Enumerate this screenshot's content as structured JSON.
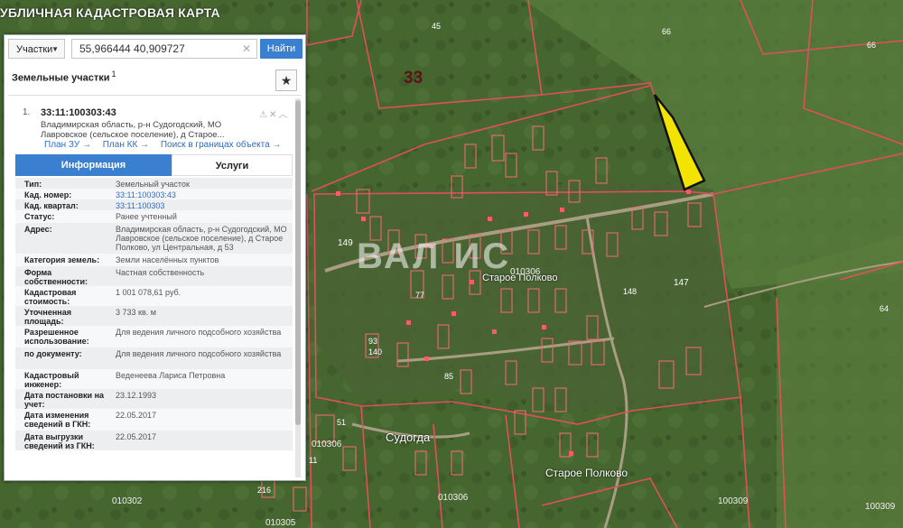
{
  "app_title": "УБЛИЧНАЯ КАДАСТРОВАЯ КАРТА",
  "search": {
    "type_label": "Участки",
    "query": "55,966444 40,909727",
    "button_label": "Найти"
  },
  "section": {
    "title": "Земельные участки",
    "count": "1"
  },
  "item": {
    "number": "1.",
    "cadastral_id": "33:11:100303:43",
    "address_short": "Владимирская область, р-н Судогодский, МО Лавровское (сельское поселение), д Старое...",
    "links": [
      "План ЗУ →",
      "План КК →",
      "Поиск в границах объекта →"
    ]
  },
  "tabs": {
    "info": "Информация",
    "services": "Услуги"
  },
  "details": [
    {
      "k": "Тип:",
      "v": "Земельный участок"
    },
    {
      "k": "Кад. номер:",
      "v": "33:11:100303:43",
      "link": true
    },
    {
      "k": "Кад. квартал:",
      "v": "33:11:100303",
      "link": true
    },
    {
      "k": "Статус:",
      "v": "Ранее учтенный"
    },
    {
      "k": "Адрес:",
      "v": "Владимирская область, р-н Судогодский, МО Лавровское (сельское поселение), д Старое Полково, ул Центральная, д 53"
    },
    {
      "k": "Категория земель:",
      "v": "Земли населённых пунктов"
    },
    {
      "k": "Форма собственности:",
      "v": "Частная собственность"
    },
    {
      "k": "Кадастровая стоимость:",
      "v": "1 001 078,61 руб."
    },
    {
      "k": "Уточненная площадь:",
      "v": "3 733 кв. м"
    },
    {
      "k": "Разрешенное использование:",
      "v": "Для ведения личного подсобного хозяйства"
    },
    {
      "k": "по документу:",
      "v": "Для ведения личного подсобного хозяйства"
    },
    {
      "k": "Кадастровый инженер:",
      "v": "Веденеева Лариса Петровна"
    },
    {
      "k": "Дата постановки на учет:",
      "v": "23.12.1993"
    },
    {
      "k": "Дата изменения сведений в ГКН:",
      "v": "22.05.2017"
    },
    {
      "k": "Дата выгрузки сведений из ГКН:",
      "v": "22.05.2017"
    }
  ],
  "map": {
    "quarter_label": "33",
    "village_1": "Старое Полково",
    "village_2": "Судогда",
    "village_3": "Старое Полково",
    "watermark": "ВАЛ ИС",
    "code_1": "010306",
    "code_2": "010302",
    "code_3": "010306",
    "code_4": "100309",
    "code_5": "100309",
    "code_6": "010305",
    "code_7": "010306",
    "parcel_labels": [
      "45",
      "66",
      "66",
      "149",
      "147",
      "148",
      "77",
      "140",
      "85",
      "93",
      "11",
      "51",
      "216",
      "64"
    ]
  },
  "colors": {
    "boundary": "#e0505a",
    "highlight": "#f2e400",
    "accent": "#3a7fd0"
  }
}
